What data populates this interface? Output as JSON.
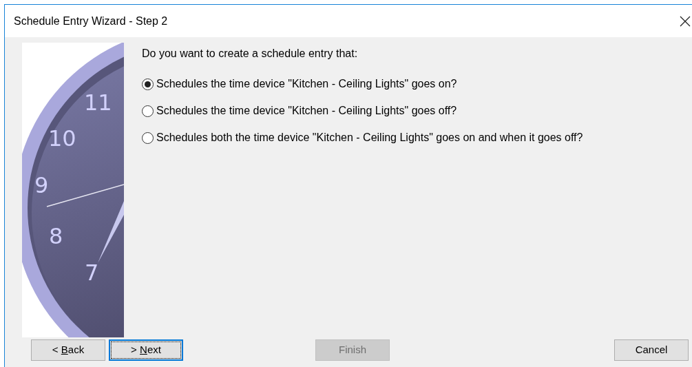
{
  "window": {
    "title": "Schedule Entry Wizard - Step 2"
  },
  "clock_numerals": [
    "11",
    "10",
    "9",
    "8",
    "7"
  ],
  "question": "Do you want to create a schedule entry that:",
  "options": [
    {
      "label": "Schedules the time device \"Kitchen - Ceiling Lights\" goes on?",
      "selected": true
    },
    {
      "label": "Schedules the time device \"Kitchen - Ceiling Lights\" goes off?",
      "selected": false
    },
    {
      "label": "Schedules both the time device \"Kitchen - Ceiling Lights\" goes on and when it goes off?",
      "selected": false
    }
  ],
  "buttons": [
    {
      "before": "< ",
      "accel": "B",
      "after": "ack",
      "disabled": false,
      "focused": false
    },
    {
      "before": "> ",
      "accel": "N",
      "after": "ext",
      "disabled": false,
      "focused": true
    },
    {
      "before": "Finish",
      "disabled": true,
      "focused": false
    },
    {
      "before": "Cancel",
      "disabled": false,
      "focused": false
    }
  ]
}
